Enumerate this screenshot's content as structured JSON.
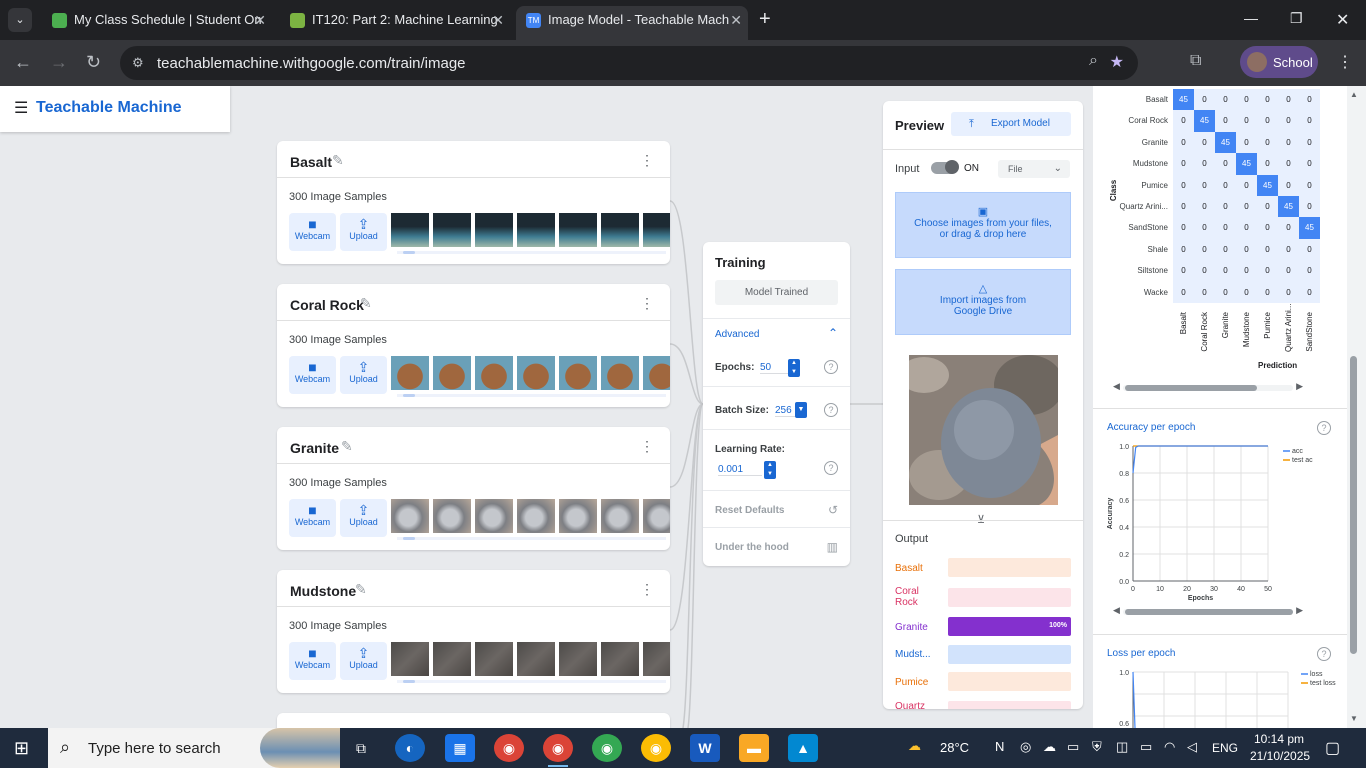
{
  "browser": {
    "tabs": [
      {
        "title": "My Class Schedule | Student On",
        "icon": "graduation-cap-icon"
      },
      {
        "title": "IT120: Part 2: Machine Learning",
        "icon": "course-icon"
      },
      {
        "title": "Image Model - Teachable Mach",
        "icon": "tm-logo-icon",
        "active": true
      }
    ],
    "url": "teachablemachine.withgoogle.com/train/image",
    "profile": "School"
  },
  "app": {
    "title": "Teachable Machine"
  },
  "classes": [
    {
      "name": "Basalt",
      "samples": "300 Image Samples",
      "swatch": "#3f5a6a"
    },
    {
      "name": "Coral Rock",
      "samples": "300 Image Samples",
      "swatch": "#a0673e"
    },
    {
      "name": "Granite",
      "samples": "300 Image Samples",
      "swatch": "#9a9da3"
    },
    {
      "name": "Mudstone",
      "samples": "300 Image Samples",
      "swatch": "#5c5a58"
    }
  ],
  "class_buttons": {
    "webcam": "Webcam",
    "upload": "Upload"
  },
  "training": {
    "title": "Training",
    "status": "Model Trained",
    "advanced": "Advanced",
    "epochs_label": "Epochs:",
    "epochs": "50",
    "batch_label": "Batch Size:",
    "batch": "256",
    "lr_label": "Learning Rate:",
    "lr": "0.001",
    "reset": "Reset Defaults",
    "hood": "Under the hood"
  },
  "preview": {
    "title": "Preview",
    "export": "Export Model",
    "input_label": "Input",
    "toggle": "ON",
    "source": "File",
    "choose_line1": "Choose images from your files,",
    "choose_line2": "or drag & drop here",
    "drive_line1": "Import images from",
    "drive_line2": "Google Drive",
    "output_label": "Output",
    "outputs": [
      {
        "label": "Basalt",
        "value": 0,
        "color": "#e8710a",
        "bg": "#fde9dc"
      },
      {
        "label": "Coral\nRock",
        "value": 0,
        "color": "#d93363",
        "bg": "#fce4e9"
      },
      {
        "label": "Granite",
        "value": 1.0,
        "pct": "100%",
        "color": "#8430ce",
        "bg": "#e9ddf6"
      },
      {
        "label": "Mudst...",
        "value": 0,
        "color": "#1967d2",
        "bg": "#d2e3fc"
      },
      {
        "label": "Pumice",
        "value": 0,
        "color": "#e8710a",
        "bg": "#fde9dc"
      },
      {
        "label": "Quartz",
        "value": 0,
        "color": "#d93363",
        "bg": "#fce4e9"
      }
    ]
  },
  "confusion": {
    "ylabel": "Class",
    "xlabel": "Prediction",
    "rows": [
      "Basalt",
      "Coral Rock",
      "Granite",
      "Mudstone",
      "Pumice",
      "Quartz Arini...",
      "SandStone",
      "Shale",
      "Siltstone",
      "Wacke"
    ],
    "cols": [
      "Basalt",
      "Coral Rock",
      "Granite",
      "Mudstone",
      "Pumice",
      "Quartz Arini...",
      "SandStone"
    ],
    "diag": "45",
    "zero": "0",
    "last_partial": "45"
  },
  "chart_data": [
    {
      "type": "line",
      "title": "Accuracy per epoch",
      "xlabel": "Epochs",
      "ylabel": "Accuracy",
      "xlim": [
        0,
        50
      ],
      "ylim": [
        0,
        1.0
      ],
      "xticks": [
        "0",
        "10",
        "20",
        "30",
        "40",
        "50"
      ],
      "yticks": [
        "0.0",
        "0.2",
        "0.4",
        "0.6",
        "0.8",
        "1.0"
      ],
      "series": [
        {
          "name": "acc",
          "color": "#4285f4",
          "x": [
            0,
            1,
            2,
            50
          ],
          "y": [
            0.8,
            0.99,
            1.0,
            1.0
          ]
        },
        {
          "name": "test ac",
          "color": "#f29900",
          "x": [
            0,
            50
          ],
          "y": [
            1.0,
            1.0
          ]
        }
      ]
    },
    {
      "type": "line",
      "title": "Loss per epoch",
      "series": [
        {
          "name": "loss",
          "color": "#4285f4"
        },
        {
          "name": "test loss",
          "color": "#f29900"
        }
      ],
      "yticks": [
        "1.0",
        "0.6"
      ]
    }
  ],
  "taskbar": {
    "search": "Type here to search",
    "weather": "28°C",
    "lang": "ENG",
    "time": "10:14 pm",
    "date": "21/10/2025"
  }
}
